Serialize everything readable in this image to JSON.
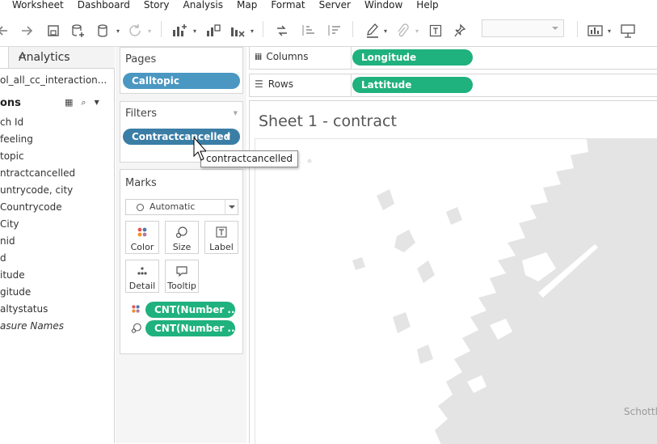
{
  "menu": [
    "Worksheet",
    "Dashboard",
    "Story",
    "Analysis",
    "Map",
    "Format",
    "Server",
    "Window",
    "Help"
  ],
  "toolbar": {
    "icons": [
      "back-icon",
      "forward-icon",
      "save-icon",
      "new-datasource-icon",
      "datasource-icon",
      "refresh-icon",
      "new-worksheet-icon",
      "duplicate-sheet-icon",
      "clear-sheet-icon",
      "swap-icon",
      "sort-ascending-icon",
      "sort-descending-icon",
      "highlight-icon",
      "attach-icon",
      "text-label-icon",
      "pin-icon",
      "show-me-icon",
      "presentation-icon"
    ],
    "fit_value": ""
  },
  "left_pane": {
    "tab_label": "Analytics",
    "datasource": "ol_all_cc_interaction...",
    "section_title": "ons",
    "fields": [
      "ch Id",
      "feeling",
      "topic",
      "ntractcancelled",
      "untrycode, city",
      "Countrycode",
      "City",
      "nid",
      "d",
      "itude",
      "gitude",
      "altystatus",
      "asure Names"
    ]
  },
  "pages": {
    "title": "Pages",
    "pill": "Calltopic"
  },
  "filters": {
    "title": "Filters",
    "pill": "Contractcancelled"
  },
  "marks": {
    "title": "Marks",
    "type": "Automatic",
    "buttons": [
      "Color",
      "Size",
      "Label",
      "Detail",
      "Tooltip"
    ],
    "pills": [
      "CNT(Number ..",
      "CNT(Number .."
    ]
  },
  "columns": {
    "label": "Columns",
    "pill": "Longitude"
  },
  "rows": {
    "label": "Rows",
    "pill": "Lattitude"
  },
  "sheet_title": "Sheet 1 - contract",
  "map_label": "Schottla",
  "tooltip": "contractcancelled",
  "colors": {
    "pill_blue": "#4a97c2",
    "pill_dark_blue": "#3a7ea6",
    "pill_green": "#1fb17e",
    "land": "#e4e4e4"
  }
}
